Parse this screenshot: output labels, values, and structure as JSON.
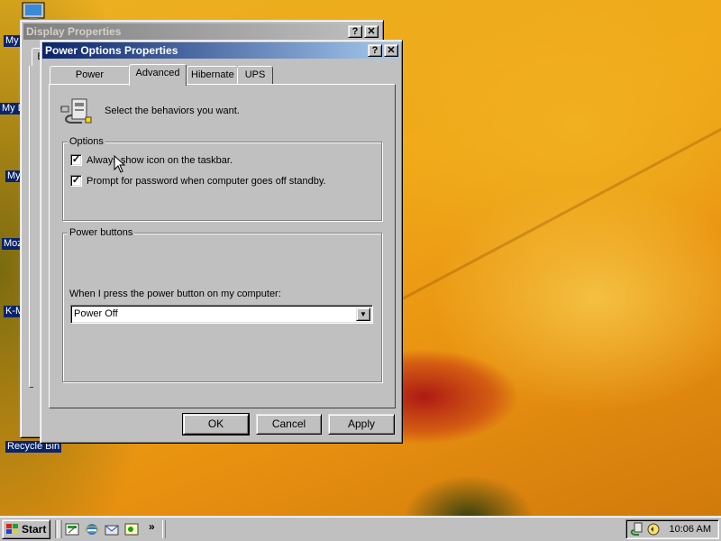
{
  "desktop": {
    "icons": [
      {
        "label": "My",
        "icon": "computer-icon"
      },
      {
        "label": "My D",
        "icon": "documents-icon"
      },
      {
        "label": "My",
        "icon": "network-icon"
      },
      {
        "label": "Moz",
        "icon": "browser-icon"
      },
      {
        "label": "K-M",
        "icon": "app-icon"
      },
      {
        "label": "Recycle Bin",
        "icon": "recycle-bin-icon"
      }
    ]
  },
  "display_window": {
    "title": "Display Properties",
    "help_label": "?",
    "close_label": "✕",
    "tab_fragment": "B"
  },
  "power_window": {
    "title": "Power Options Properties",
    "help_label": "?",
    "close_label": "✕",
    "tabs": [
      {
        "label": "Power Schemes"
      },
      {
        "label": "Advanced"
      },
      {
        "label": "Hibernate"
      },
      {
        "label": "UPS"
      }
    ],
    "selected_tab": "Advanced",
    "intro_text": "Select the behaviors you want.",
    "options": {
      "title": "Options",
      "items": [
        {
          "label": "Always show icon on the taskbar.",
          "checked": true
        },
        {
          "label": "Prompt for password when computer goes off standby.",
          "checked": true
        }
      ]
    },
    "power_buttons": {
      "title": "Power buttons",
      "prompt": "When I press the power button on my computer:",
      "selected_value": "Power Off"
    },
    "buttons": {
      "ok": "OK",
      "cancel": "Cancel",
      "apply": "Apply"
    }
  },
  "taskbar": {
    "start_label": "Start",
    "chevron": "»",
    "clock": "10:06 AM"
  },
  "colors": {
    "title_active": "#0a246a",
    "window_bg": "#c0c0c0",
    "selection": "#0a246a"
  }
}
